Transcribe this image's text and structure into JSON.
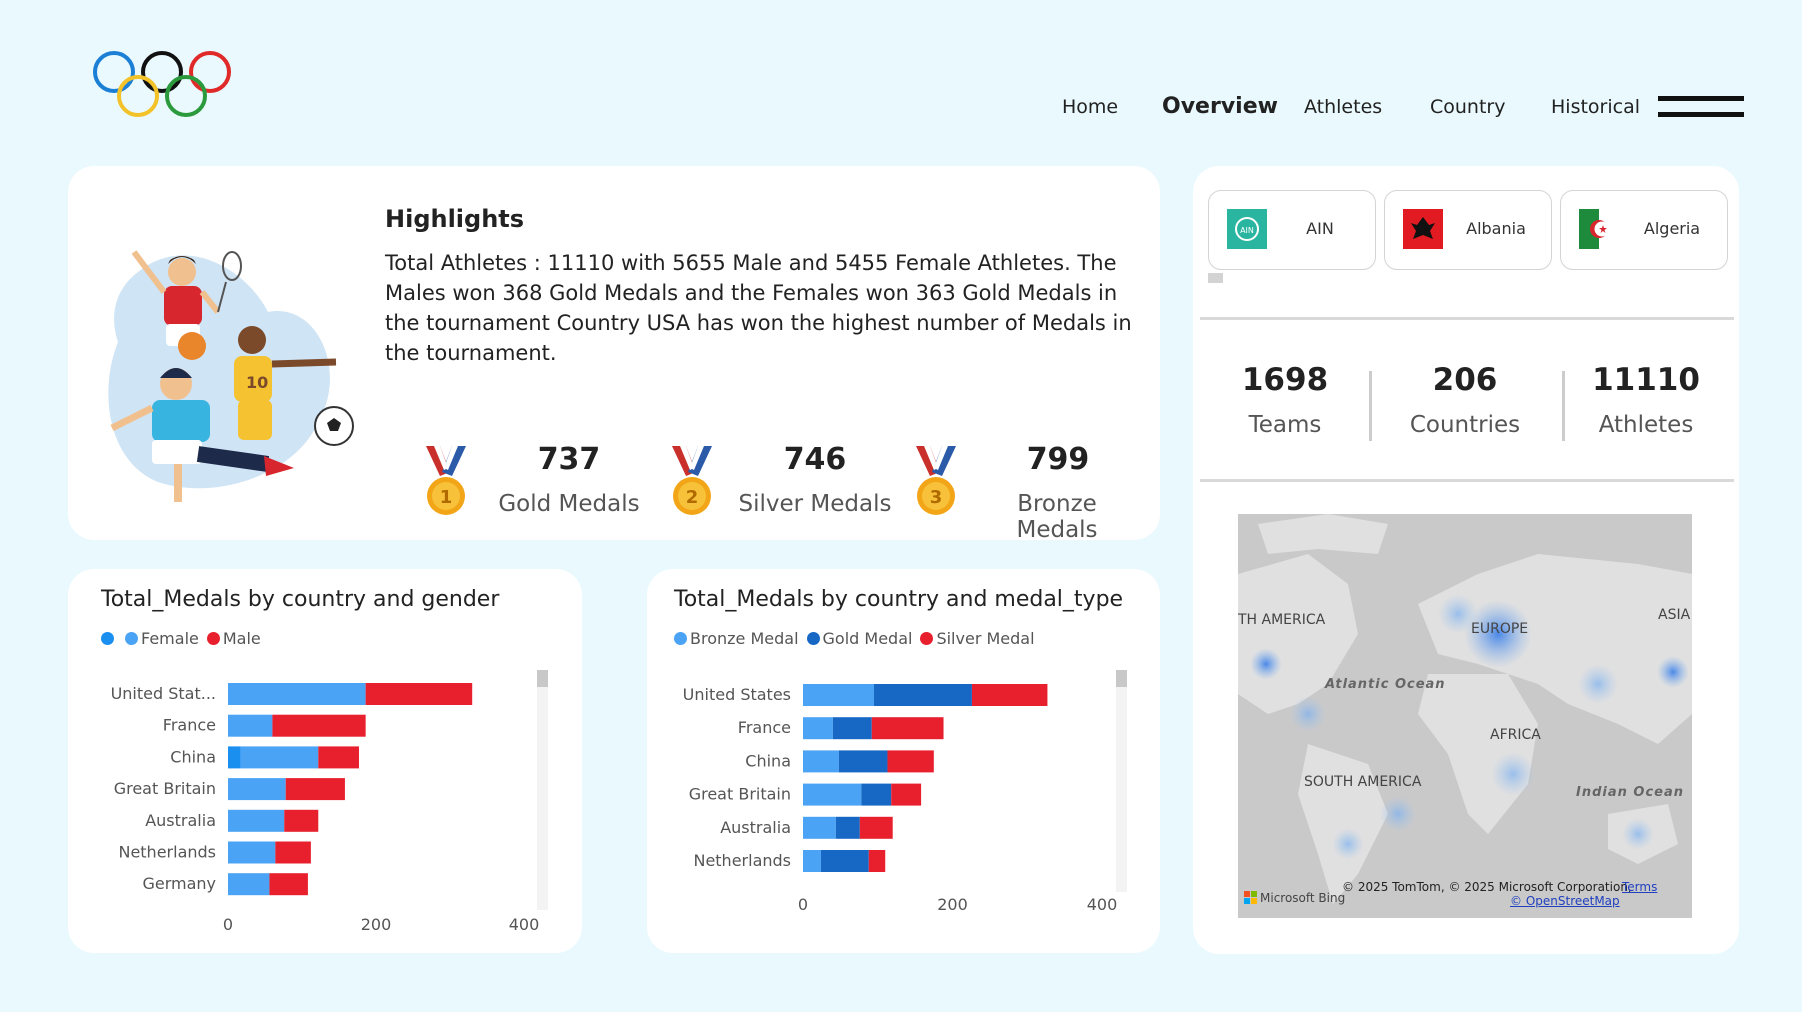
{
  "nav": {
    "items": [
      {
        "label": "Home",
        "active": false
      },
      {
        "label": "Overview",
        "active": true
      },
      {
        "label": "Athletes",
        "active": false
      },
      {
        "label": "Country",
        "active": false
      },
      {
        "label": "Historical",
        "active": false
      }
    ]
  },
  "highlights": {
    "title": "Highlights",
    "text": "Total Athletes : 11110 with 5655 Male and 5455 Female Athletes. The Males won 368 Gold Medals and the Females won 363 Gold Medals in the tournament Country USA has won the highest number of Medals in the tournament.",
    "medals": [
      {
        "count": "737",
        "label": "Gold Medals",
        "rank": "1"
      },
      {
        "count": "746",
        "label": "Silver Medals",
        "rank": "2"
      },
      {
        "count": "799",
        "label": "Bronze Medals",
        "rank": "3"
      }
    ]
  },
  "country_chips": [
    {
      "name": "AIN"
    },
    {
      "name": "Albania"
    },
    {
      "name": "Algeria"
    }
  ],
  "kpis": [
    {
      "value": "1698",
      "label": "Teams"
    },
    {
      "value": "206",
      "label": "Countries"
    },
    {
      "value": "11110",
      "label": "Athletes"
    }
  ],
  "colors": {
    "female": "#4ba3f5",
    "male": "#e8202e",
    "bronze": "#4ba3f5",
    "gold": "#1668c4",
    "silver": "#e8202e",
    "background": "#e9f9fd"
  },
  "chart_data": [
    {
      "type": "bar",
      "orientation": "horizontal",
      "stacked": true,
      "title": "Total_Medals by country and gender",
      "legend": [
        "",
        "Female",
        "Male"
      ],
      "categories": [
        "United Stat...",
        "France",
        "China",
        "Great Britain",
        "Australia",
        "Netherlands",
        "Germany"
      ],
      "series": [
        {
          "name": "",
          "values": [
            0,
            0,
            17,
            0,
            0,
            0,
            0
          ]
        },
        {
          "name": "Female",
          "values": [
            186,
            60,
            105,
            78,
            76,
            64,
            56
          ]
        },
        {
          "name": "Male",
          "values": [
            144,
            126,
            55,
            80,
            46,
            48,
            52
          ]
        }
      ],
      "xticks": [
        "0",
        "200",
        "400"
      ],
      "xlim": [
        0,
        400
      ]
    },
    {
      "type": "bar",
      "orientation": "horizontal",
      "stacked": true,
      "title": "Total_Medals by country and medal_type",
      "legend": [
        "Bronze Medal",
        "Gold Medal",
        "Silver Medal"
      ],
      "categories": [
        "United States",
        "France",
        "China",
        "Great Britain",
        "Australia",
        "Netherlands"
      ],
      "series": [
        {
          "name": "Bronze Medal",
          "values": [
            95,
            40,
            48,
            78,
            44,
            24
          ]
        },
        {
          "name": "Gold Medal",
          "values": [
            131,
            52,
            65,
            40,
            32,
            64
          ]
        },
        {
          "name": "Silver Medal",
          "values": [
            101,
            96,
            62,
            40,
            44,
            22
          ]
        }
      ],
      "xticks": [
        "0",
        "200",
        "400"
      ],
      "xlim": [
        0,
        400
      ]
    }
  ],
  "map": {
    "labels": {
      "north_america": "TH AMERICA",
      "europe": "EUROPE",
      "asia": "ASIA",
      "atlantic": "Atlantic Ocean",
      "africa": "AFRICA",
      "south_america": "SOUTH AMERICA",
      "indian": "Indian Ocean"
    },
    "provider": "Microsoft Bing",
    "copyright": "© 2025 TomTom, © 2025 Microsoft Corporation,",
    "terms": "Terms",
    "osm": "© OpenStreetMap"
  }
}
